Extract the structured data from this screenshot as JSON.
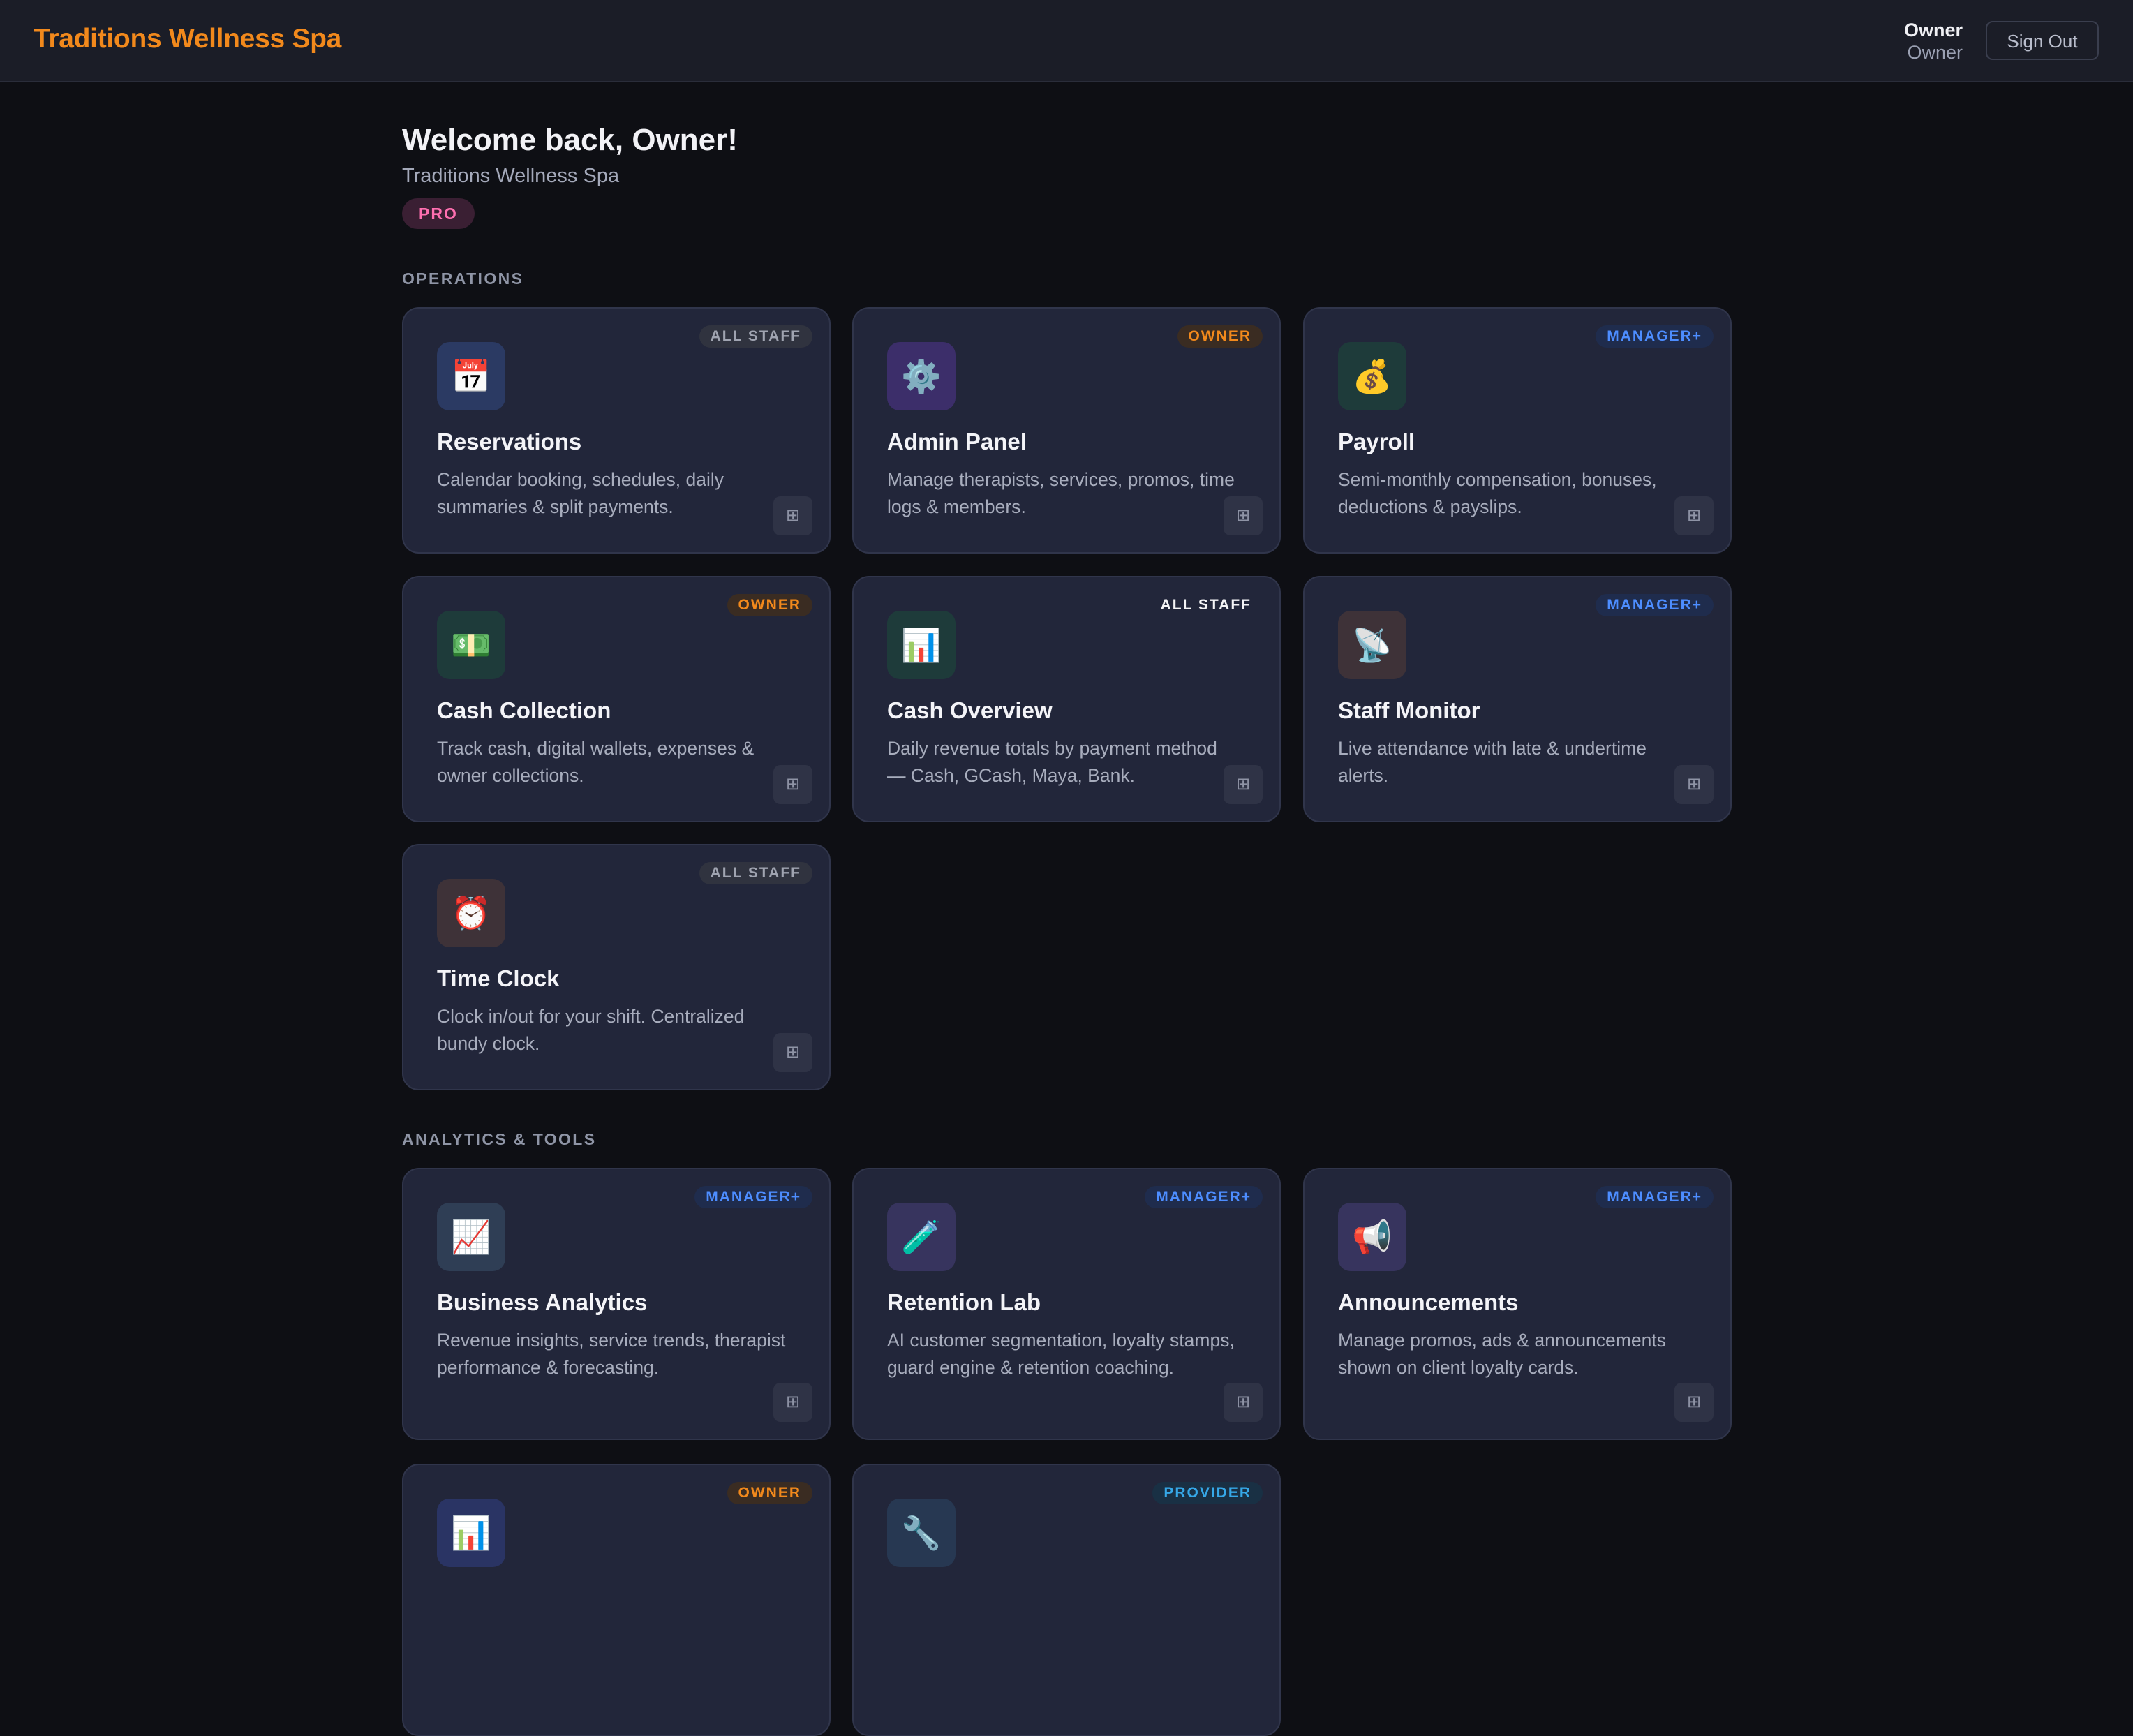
{
  "header": {
    "brand": "Traditions Wellness Spa",
    "user_name": "Owner",
    "user_role": "Owner",
    "signout_label": "Sign Out"
  },
  "welcome": {
    "title": "Welcome back, Owner!",
    "subtitle": "Traditions Wellness Spa",
    "plan_badge": "PRO"
  },
  "sections": {
    "operations": "OPERATIONS",
    "analytics": "ANALYTICS & TOOLS"
  },
  "icons": {
    "reservations": "calendar-icon",
    "admin": "gear-icon",
    "payroll": "money-bag-icon",
    "cash_collection": "banknote-icon",
    "cash_overview": "bar-chart-icon",
    "staff_monitor": "satellite-dish-icon",
    "time_clock": "alarm-clock-icon",
    "business_analytics": "trend-chart-icon",
    "retention_lab": "test-tube-icon",
    "announcements": "megaphone-icon",
    "owner_report": "bar-chart-icon",
    "provider_tool": "wrench-icon",
    "tile_action": "grid-icon"
  },
  "cards": {
    "reservations": {
      "badge": "ALL STAFF",
      "glyph": "📅",
      "title": "Reservations",
      "desc": "Calendar booking, schedules, daily summaries & split payments."
    },
    "admin": {
      "badge": "OWNER",
      "glyph": "⚙️",
      "title": "Admin Panel",
      "desc": "Manage therapists, services, promos, time logs & members."
    },
    "payroll": {
      "badge": "MANAGER+",
      "glyph": "💰",
      "title": "Payroll",
      "desc": "Semi-monthly compensation, bonuses, deductions & payslips."
    },
    "cash_collection": {
      "badge": "OWNER",
      "glyph": "💵",
      "title": "Cash Collection",
      "desc": "Track cash, digital wallets, expenses & owner collections."
    },
    "cash_overview": {
      "badge": "ALL STAFF",
      "glyph": "📊",
      "title": "Cash Overview",
      "desc": "Daily revenue totals by payment method — Cash, GCash, Maya, Bank."
    },
    "staff_monitor": {
      "badge": "MANAGER+",
      "glyph": "📡",
      "title": "Staff Monitor",
      "desc": "Live attendance with late & undertime alerts."
    },
    "time_clock": {
      "badge": "ALL STAFF",
      "glyph": "⏰",
      "title": "Time Clock",
      "desc": "Clock in/out for your shift. Centralized bundy clock."
    },
    "business_analytics": {
      "badge": "MANAGER+",
      "glyph": "📈",
      "title": "Business Analytics",
      "desc": "Revenue insights, service trends, therapist performance & forecasting."
    },
    "retention_lab": {
      "badge": "MANAGER+",
      "glyph": "🧪",
      "title": "Retention Lab",
      "desc": "AI customer segmentation, loyalty stamps, guard engine & retention coaching."
    },
    "announcements": {
      "badge": "MANAGER+",
      "glyph": "📢",
      "title": "Announcements",
      "desc": "Manage promos, ads & announcements shown on client loyalty cards."
    },
    "owner_report": {
      "badge": "OWNER",
      "glyph": "📊"
    },
    "provider_tool": {
      "badge": "PROVIDER",
      "glyph": "🔧"
    }
  },
  "tile_action_glyph": "⊞",
  "colors": {
    "brand": "#f2891c",
    "pro": "#ff6fb0",
    "manager": "#4d8dff",
    "provider": "#36a8e8",
    "background": "#0e0f14",
    "card": "#22263a"
  }
}
